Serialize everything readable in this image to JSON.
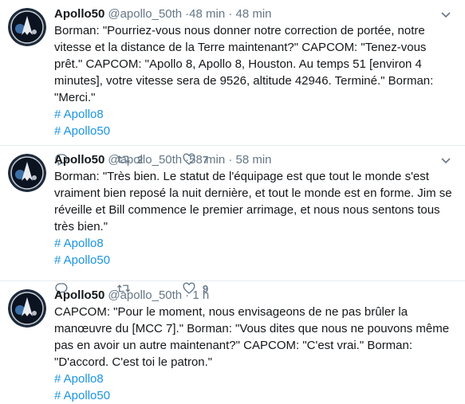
{
  "colors": {
    "link": "#1b95e0",
    "meta": "#657786",
    "text": "#14171a",
    "divider": "#e6ecf0"
  },
  "tweets": [
    {
      "name": "Apollo50",
      "handle": "@apollo_50th",
      "time": "·48 min · 48 min",
      "text": "Borman: \"Pourriez-vous nous donner notre correction de portée, notre vitesse et la distance de la Terre maintenant?\" CAPCOM: \"Tenez-vous prêt.\" CAPCOM: \"Apollo 8, Apollo 8, Houston. Au temps 51 [environ 4 minutes], votre vitesse sera de 9526, altitude 42946. Terminé.\" Borman: \"Merci.\"",
      "hashtags": [
        "# Apollo8",
        "# Apollo50"
      ],
      "retweets": "2",
      "likes": "7",
      "avatar_icon": "apollo-nasa-patch-icon"
    },
    {
      "name": "Apollo50",
      "handle": "@apollo_50th",
      "time": "·58 min · 58 min",
      "text": "Borman: \"Très bien. Le statut de l'équipage est que tout le monde s'est vraiment bien reposé la nuit dernière, et tout le monde est en forme. Jim se réveille et Bill commence le premier arrimage, et nous nous sentons tous très bien.\"",
      "hashtags": [
        "# Apollo8",
        "# Apollo50"
      ],
      "retweets": "",
      "likes": "9",
      "avatar_icon": "apollo-nasa-patch-icon"
    },
    {
      "name": "Apollo50",
      "handle": "@apollo_50th",
      "time": "· 1 h",
      "text": "CAPCOM: \"Pour le moment, nous envisageons de ne pas brûler la manœuvre du [MCC 7].\" Borman: \"Vous dites que nous ne pouvons même pas en avoir un autre maintenant?\" CAPCOM: \"C'est vrai.\" Borman: \"D'accord. C'est toi le patron.\"",
      "hashtags": [
        "# Apollo8",
        "# Apollo50"
      ],
      "retweets": "",
      "likes": "",
      "avatar_icon": "apollo-nasa-patch-icon"
    }
  ]
}
